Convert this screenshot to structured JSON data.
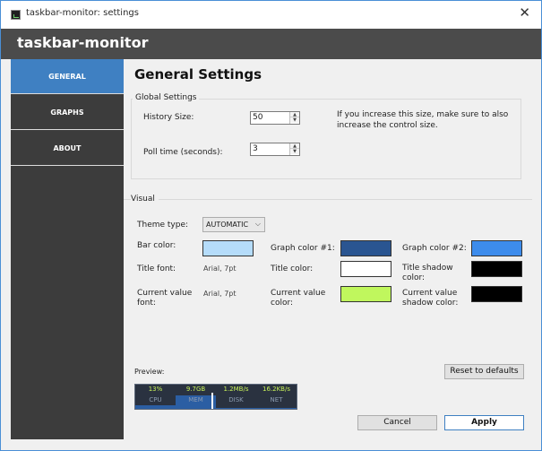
{
  "window": {
    "title": "taskbar-monitor: settings",
    "close_glyph": "✕",
    "icon": "app-monitor-icon"
  },
  "header": {
    "app_name": "taskbar-monitor"
  },
  "sidebar": {
    "items": [
      {
        "label": "GENERAL",
        "active": true
      },
      {
        "label": "GRAPHS",
        "active": false
      },
      {
        "label": "ABOUT",
        "active": false
      }
    ]
  },
  "page": {
    "title": "General Settings"
  },
  "global_settings": {
    "legend": "Global Settings",
    "history_size_label": "History Size:",
    "history_size_value": "50",
    "poll_time_label": "Poll time (seconds):",
    "poll_time_value": "3",
    "hint": "If you increase this size, make sure to also increase the control size.",
    "spin_up_glyph": "▲",
    "spin_down_glyph": "▼"
  },
  "visual": {
    "legend": "Visual",
    "theme_type_label": "Theme type:",
    "theme_type_value": "AUTOMATIC",
    "chevron_glyph": "⌵",
    "bar_color_label": "Bar color:",
    "graph_color_1_label": "Graph color #1:",
    "graph_color_2_label": "Graph color #2:",
    "title_font_label": "Title font:",
    "title_font_value": "Arial, 7pt",
    "title_color_label": "Title color:",
    "title_shadow_color_label": "Title shadow color:",
    "current_value_font_label": "Current value font:",
    "current_value_font_value": "Arial, 7pt",
    "current_value_color_label": "Current value color:",
    "current_value_shadow_color_label": "Current value shadow color:",
    "colors": {
      "bar": "#b5dcfa",
      "graph_1": "#2a5591",
      "graph_2": "#3d8cec",
      "title": "#ffffff",
      "title_shadow": "#000000",
      "current_value": "#c0f75d",
      "current_value_shadow": "#000000"
    }
  },
  "preview": {
    "label": "Preview:",
    "cells": [
      {
        "value": "13%",
        "name": "CPU",
        "level": 0.15
      },
      {
        "value": "9.7GB",
        "name": "MEM",
        "level": 0.55
      },
      {
        "value": "1.2MB/s",
        "name": "DISK",
        "level": 0.05
      },
      {
        "value": "16.2KB/s",
        "name": "NET",
        "level": 0.05
      }
    ]
  },
  "buttons": {
    "reset": "Reset to defaults",
    "cancel": "Cancel",
    "apply": "Apply"
  }
}
